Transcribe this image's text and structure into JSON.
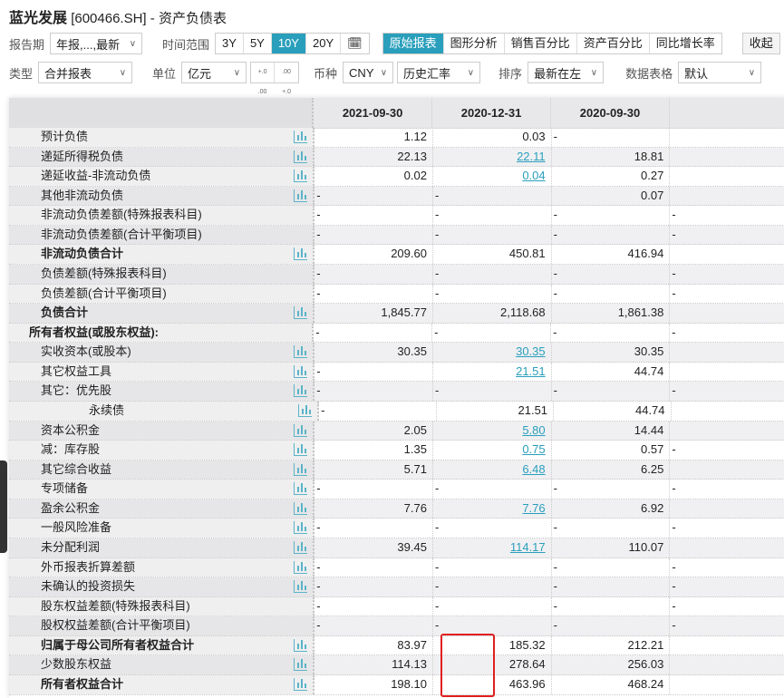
{
  "header": {
    "company": "蓝光发展",
    "code": "[600466.SH]",
    "sep": "-",
    "report": "资产负债表"
  },
  "toolbar1": {
    "period_label": "报告期",
    "period_value": "年报,...,最新",
    "range_label": "时间范围",
    "ranges": [
      "3Y",
      "5Y",
      "10Y",
      "20Y"
    ],
    "active_range": "10Y",
    "views": [
      "原始报表",
      "图形分析",
      "销售百分比",
      "资产百分比",
      "同比增长率"
    ],
    "active_view": "原始报表",
    "collapse": "收起"
  },
  "toolbar2": {
    "type_label": "类型",
    "type_value": "合并报表",
    "unit_label": "单位",
    "unit_value": "亿元",
    "dec_plus": "+.0 .00",
    "dec_minus": ".00 +.0",
    "currency_label": "币种",
    "currency_value": "CNY",
    "rate_value": "历史汇率",
    "sort_label": "排序",
    "sort_value": "最新在左",
    "format_label": "数据表格",
    "format_value": "默认"
  },
  "columns": [
    "2021-09-30",
    "2020-12-31",
    "2020-09-30"
  ],
  "rows": [
    {
      "label": "预计负债",
      "v": [
        "1.12",
        "0.03",
        "-",
        ""
      ],
      "icon": true
    },
    {
      "label": "递延所得税负债",
      "v": [
        "22.13",
        "22.11",
        "18.81",
        ""
      ],
      "icon": true,
      "link": true
    },
    {
      "label": "递延收益-非流动负债",
      "v": [
        "0.02",
        "0.04",
        "0.27",
        ""
      ],
      "icon": true,
      "link": true
    },
    {
      "label": "其他非流动负债",
      "v": [
        "-",
        "-",
        "0.07",
        ""
      ],
      "icon": true
    },
    {
      "label": "非流动负债差额(特殊报表科目)",
      "v": [
        "-",
        "-",
        "-",
        "-"
      ],
      "icon": false
    },
    {
      "label": "非流动负债差额(合计平衡项目)",
      "v": [
        "-",
        "-",
        "-",
        "-"
      ],
      "icon": false
    },
    {
      "label": "非流动负债合计",
      "v": [
        "209.60",
        "450.81",
        "416.94",
        ""
      ],
      "icon": true,
      "bold": true
    },
    {
      "label": "负债差额(特殊报表科目)",
      "v": [
        "-",
        "-",
        "-",
        "-"
      ],
      "icon": false
    },
    {
      "label": "负债差额(合计平衡项目)",
      "v": [
        "-",
        "-",
        "-",
        "-"
      ],
      "icon": false
    },
    {
      "label": "负债合计",
      "v": [
        "1,845.77",
        "2,118.68",
        "1,861.38",
        ""
      ],
      "icon": true,
      "bold": true
    },
    {
      "label": "所有者权益(或股东权益):",
      "v": [
        "-",
        "-",
        "-",
        "-"
      ],
      "icon": false,
      "bold": true,
      "top": true
    },
    {
      "label": "实收资本(或股本)",
      "v": [
        "30.35",
        "30.35",
        "30.35",
        ""
      ],
      "icon": true,
      "link": true
    },
    {
      "label": "其它权益工具",
      "v": [
        "-",
        "21.51",
        "44.74",
        ""
      ],
      "icon": true,
      "link": true
    },
    {
      "label": "其它：优先股",
      "v": [
        "-",
        "-",
        "-",
        "-"
      ],
      "icon": true
    },
    {
      "label": "永续债",
      "v": [
        "-",
        "21.51",
        "44.74",
        ""
      ],
      "icon": true,
      "deep": true
    },
    {
      "label": "资本公积金",
      "v": [
        "2.05",
        "5.80",
        "14.44",
        ""
      ],
      "icon": true,
      "link": true
    },
    {
      "label": "减：库存股",
      "v": [
        "1.35",
        "0.75",
        "0.57",
        "-"
      ],
      "icon": true,
      "link": true
    },
    {
      "label": "其它综合收益",
      "v": [
        "5.71",
        "6.48",
        "6.25",
        ""
      ],
      "icon": true,
      "link": true
    },
    {
      "label": "专项储备",
      "v": [
        "-",
        "-",
        "-",
        "-"
      ],
      "icon": true
    },
    {
      "label": "盈余公积金",
      "v": [
        "7.76",
        "7.76",
        "6.92",
        ""
      ],
      "icon": true,
      "link": true
    },
    {
      "label": "一般风险准备",
      "v": [
        "-",
        "-",
        "-",
        "-"
      ],
      "icon": true
    },
    {
      "label": "未分配利润",
      "v": [
        "39.45",
        "114.17",
        "110.07",
        ""
      ],
      "icon": true,
      "link": true
    },
    {
      "label": "外币报表折算差额",
      "v": [
        "-",
        "-",
        "-",
        "-"
      ],
      "icon": true
    },
    {
      "label": "未确认的投资损失",
      "v": [
        "-",
        "-",
        "-",
        "-"
      ],
      "icon": true
    },
    {
      "label": "股东权益差额(特殊报表科目)",
      "v": [
        "-",
        "-",
        "-",
        "-"
      ],
      "icon": false
    },
    {
      "label": "股权权益差额(合计平衡项目)",
      "v": [
        "-",
        "-",
        "-",
        "-"
      ],
      "icon": false
    },
    {
      "label": "归属于母公司所有者权益合计",
      "v": [
        "83.97",
        "185.32",
        "212.21",
        ""
      ],
      "icon": true,
      "bold": true
    },
    {
      "label": "少数股东权益",
      "v": [
        "114.13",
        "278.64",
        "256.03",
        ""
      ],
      "icon": true
    },
    {
      "label": "所有者权益合计",
      "v": [
        "198.10",
        "463.96",
        "468.24",
        ""
      ],
      "icon": true,
      "bold": true
    }
  ]
}
